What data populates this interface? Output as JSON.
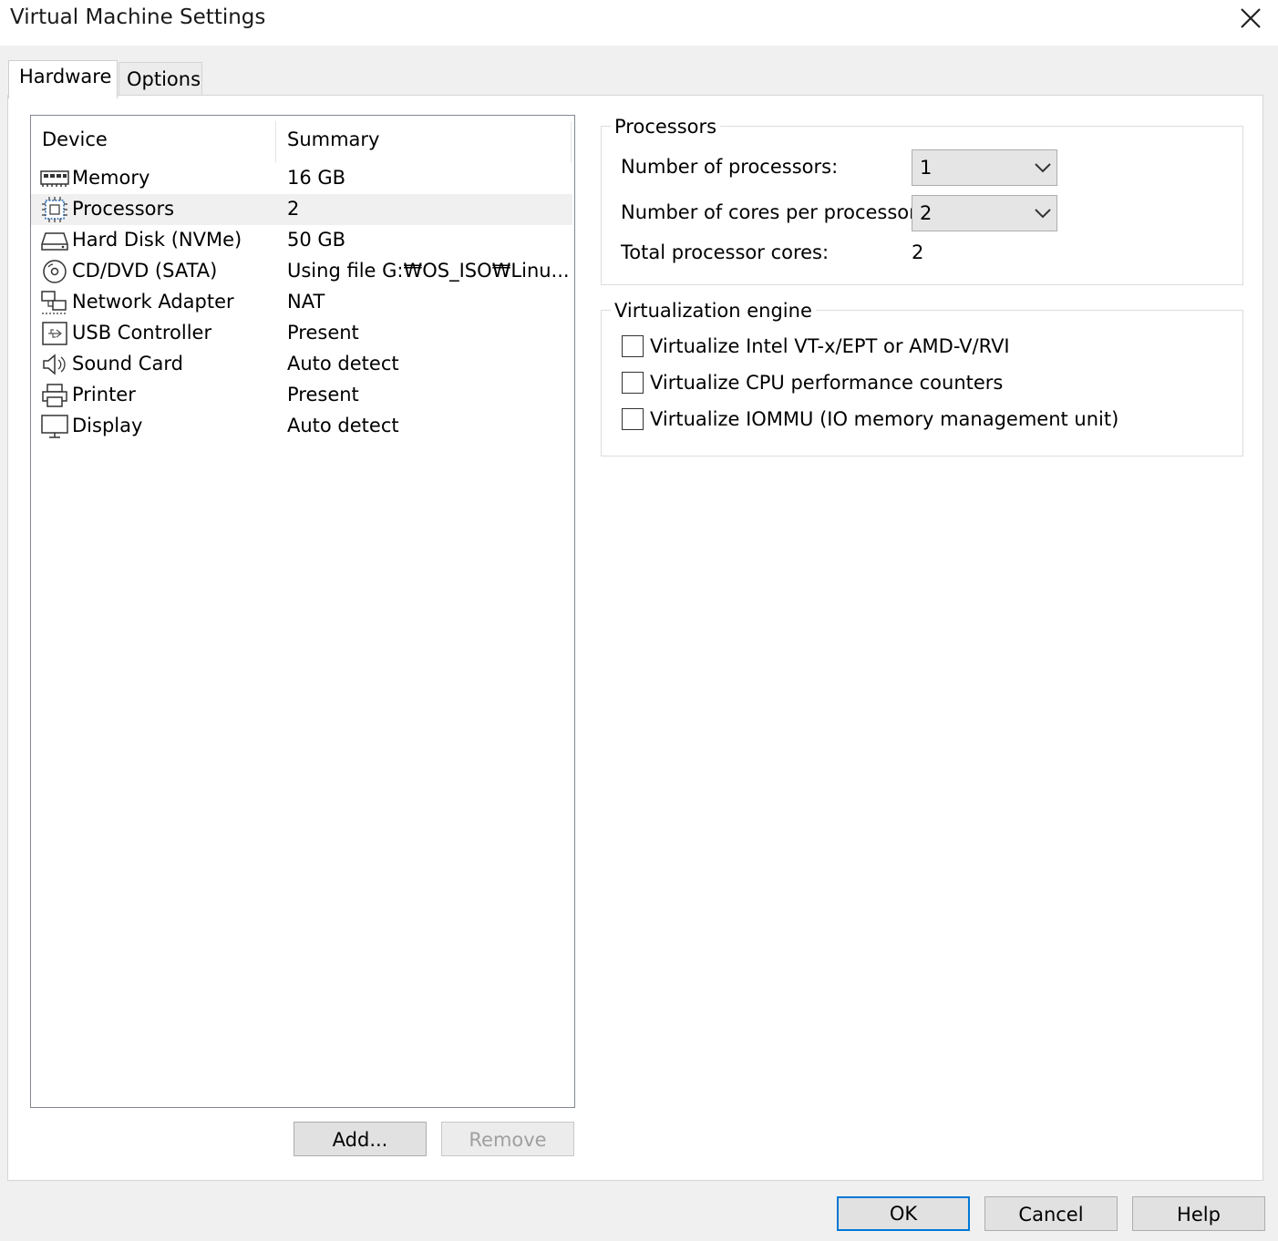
{
  "window": {
    "title": "Virtual Machine Settings"
  },
  "tabs": [
    {
      "label": "Hardware",
      "active": true
    },
    {
      "label": "Options",
      "active": false
    }
  ],
  "device_list": {
    "columns": [
      "Device",
      "Summary"
    ],
    "rows": [
      {
        "icon": "memory-icon",
        "name": "Memory",
        "summary": "16 GB",
        "selected": false
      },
      {
        "icon": "processor-icon",
        "name": "Processors",
        "summary": "2",
        "selected": true
      },
      {
        "icon": "hard-disk-icon",
        "name": "Hard Disk (NVMe)",
        "summary": "50 GB",
        "selected": false
      },
      {
        "icon": "cd-dvd-icon",
        "name": "CD/DVD (SATA)",
        "summary": "Using file G:₩OS_ISO₩Linu...",
        "selected": false
      },
      {
        "icon": "network-adapter-icon",
        "name": "Network Adapter",
        "summary": "NAT",
        "selected": false
      },
      {
        "icon": "usb-controller-icon",
        "name": "USB Controller",
        "summary": "Present",
        "selected": false
      },
      {
        "icon": "sound-card-icon",
        "name": "Sound Card",
        "summary": "Auto detect",
        "selected": false
      },
      {
        "icon": "printer-icon",
        "name": "Printer",
        "summary": "Present",
        "selected": false
      },
      {
        "icon": "display-icon",
        "name": "Display",
        "summary": "Auto detect",
        "selected": false
      }
    ]
  },
  "list_buttons": {
    "add": "Add...",
    "remove": "Remove"
  },
  "processors_group": {
    "title": "Processors",
    "num_processors_label": "Number of processors:",
    "num_processors_value": "1",
    "cores_label": "Number of cores per processor:",
    "cores_value": "2",
    "total_label": "Total processor cores:",
    "total_value": "2"
  },
  "virtualization_group": {
    "title": "Virtualization engine",
    "options": [
      {
        "label": "Virtualize Intel VT-x/EPT or AMD-V/RVI",
        "checked": false
      },
      {
        "label": "Virtualize CPU performance counters",
        "checked": false
      },
      {
        "label": "Virtualize IOMMU (IO memory management unit)",
        "checked": false
      }
    ]
  },
  "footer": {
    "ok": "OK",
    "cancel": "Cancel",
    "help": "Help"
  }
}
